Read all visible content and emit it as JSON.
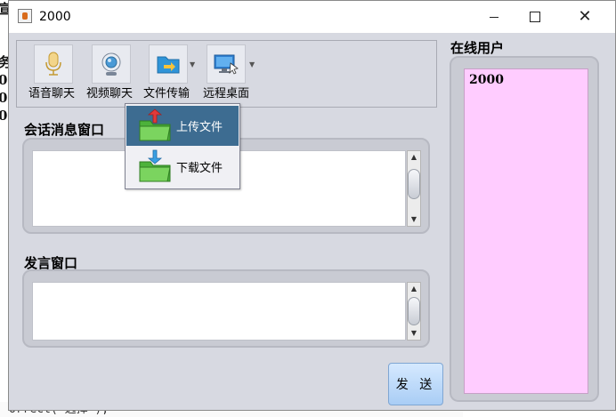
{
  "background": {
    "left_fragments": [
      "务",
      "0",
      "0",
      "0"
    ],
    "bottom_text": "orrect(\"选择\");",
    "top_fragment": "宣"
  },
  "window": {
    "title": "2000",
    "controls": {
      "minimize": "—",
      "maximize": "☐",
      "close": "✕"
    }
  },
  "toolbar": {
    "buttons": [
      {
        "label": "语音聊天",
        "icon": "microphone-icon"
      },
      {
        "label": "视频聊天",
        "icon": "webcam-icon"
      },
      {
        "label": "文件传输",
        "icon": "folder-transfer-icon",
        "has_dropdown": true
      },
      {
        "label": "远程桌面",
        "icon": "remote-desktop-icon",
        "has_dropdown": true
      }
    ]
  },
  "popup_menu": {
    "items": [
      {
        "label": "上传文件",
        "icon": "folder-upload-icon",
        "active": true
      },
      {
        "label": "下载文件",
        "icon": "folder-download-icon",
        "active": false
      }
    ]
  },
  "session": {
    "label": "会话消息窗口",
    "content": ""
  },
  "compose": {
    "label": "发言窗口",
    "content": "",
    "send_label": "发 送"
  },
  "online_users": {
    "label": "在线用户",
    "users": [
      "2000"
    ]
  },
  "colors": {
    "window_bg": "#d7d9e1",
    "users_list_bg": "#ffccff",
    "menu_active_bg": "#3d6c91",
    "send_button": "#b9d8fb"
  }
}
